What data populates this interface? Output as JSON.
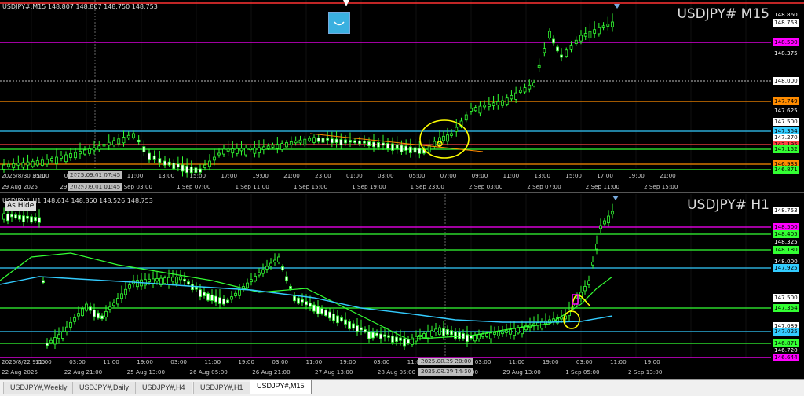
{
  "m15": {
    "info": "USDJPY#,M15  148.807 148.807 148.750 148.753",
    "title": "USDJPY# M15",
    "price_labels": [
      {
        "text": "148.860",
        "color": "#ffffff",
        "bg": "#000000"
      },
      {
        "text": "148.753",
        "color": "#000000",
        "bg": "#ffffff"
      },
      {
        "text": "148.500",
        "color": "#000000",
        "bg": "#ff00ff"
      },
      {
        "text": "148.375",
        "color": "#ffffff",
        "bg": "#000000"
      },
      {
        "text": "148.000",
        "color": "#000000",
        "bg": "#ffffff"
      },
      {
        "text": "147.749",
        "color": "#000000",
        "bg": "#ff8c00"
      },
      {
        "text": "147.625",
        "color": "#ffffff",
        "bg": "#000000"
      },
      {
        "text": "147.500",
        "color": "#000000",
        "bg": "#ffffff"
      },
      {
        "text": "147.354",
        "color": "#000000",
        "bg": "#33ccff"
      },
      {
        "text": "147.270",
        "color": "#000000",
        "bg": "#ffffff"
      },
      {
        "text": "147.195",
        "color": "#000000",
        "bg": "#ff4444"
      },
      {
        "text": "147.152",
        "color": "#000000",
        "bg": "#33ff33"
      },
      {
        "text": "146.933",
        "color": "#000000",
        "bg": "#ff8c00"
      },
      {
        "text": "146.871",
        "color": "#000000",
        "bg": "#33ff33"
      }
    ],
    "time_labels": [
      "29 Aug 2025",
      "29 Aug 21:00",
      "1 Sep 03:00",
      "1 Sep 07:00",
      "1 Sep 11:00",
      "1 Sep 15:00",
      "1 Sep 19:00",
      "1 Sep 23:00",
      "2 Sep 03:00",
      "2 Sep 07:00",
      "2 Sep 11:00",
      "2 Sep 15:00"
    ],
    "hour_labels": [
      "2025/8/30 3:00",
      "05:00",
      "07:00",
      "09:00",
      "11:00",
      "13:00",
      "15:00",
      "17:00",
      "19:00",
      "21:00",
      "23:00",
      "01:00",
      "03:00",
      "05:00",
      "07:00",
      "09:00",
      "11:00",
      "13:00",
      "15:00",
      "17:00",
      "19:00",
      "21:00"
    ],
    "crosshair_times": [
      "2025.09.01 07:45",
      "2025.09.01 01:45"
    ]
  },
  "h1": {
    "info": "USDJPY#,H1  148.614 148.860 148.526 148.753",
    "title": "USDJPY# H1",
    "as_hide": "As Hide",
    "price_labels": [
      {
        "text": "148.753",
        "color": "#000000",
        "bg": "#ffffff"
      },
      {
        "text": "148.500",
        "color": "#000000",
        "bg": "#ff00ff"
      },
      {
        "text": "148.405",
        "color": "#000000",
        "bg": "#33ff33"
      },
      {
        "text": "148.325",
        "color": "#ffffff",
        "bg": "#000000"
      },
      {
        "text": "148.180",
        "color": "#000000",
        "bg": "#33ff33"
      },
      {
        "text": "148.000",
        "color": "#ffffff",
        "bg": "#000000"
      },
      {
        "text": "147.925",
        "color": "#000000",
        "bg": "#33ccff"
      },
      {
        "text": "147.500",
        "color": "#000000",
        "bg": "#ffffff"
      },
      {
        "text": "147.354",
        "color": "#000000",
        "bg": "#33ff33"
      },
      {
        "text": "147.089",
        "color": "#000000",
        "bg": "#ffffff"
      },
      {
        "text": "147.025",
        "color": "#000000",
        "bg": "#33ccff"
      },
      {
        "text": "146.871",
        "color": "#000000",
        "bg": "#33ff33"
      },
      {
        "text": "146.720",
        "color": "#ffffff",
        "bg": "#000000"
      },
      {
        "text": "146.644",
        "color": "#000000",
        "bg": "#ff00ff"
      }
    ],
    "time_labels": [
      "22 Aug 2025",
      "22 Aug 21:00",
      "25 Aug 13:00",
      "26 Aug 05:00",
      "26 Aug 21:00",
      "27 Aug 13:00",
      "28 Aug 05:00",
      "28 Aug 21:00",
      "29 Aug 13:00",
      "1 Sep 05:00",
      "2 Sep 13:00"
    ],
    "hour_labels": [
      "2025/8/22 9:00",
      "11:00",
      "03:00",
      "11:00",
      "19:00",
      "03:00",
      "11:00",
      "19:00",
      "03:00",
      "11:00",
      "19:00",
      "03:00",
      "11:00",
      "19:00",
      "03:00",
      "11:00",
      "19:00",
      "03:00",
      "11:00",
      "19:00"
    ],
    "crosshair_times": [
      "2025.08.29 20:00",
      "2025.08.29 14:00"
    ]
  },
  "tabs": [
    "USDJPY#,Weekly",
    "USDJPY#,Daily",
    "USDJPY#,H4",
    "USDJPY#,H1",
    "USDJPY#,M15"
  ],
  "active_tab": "USDJPY#,M15"
}
